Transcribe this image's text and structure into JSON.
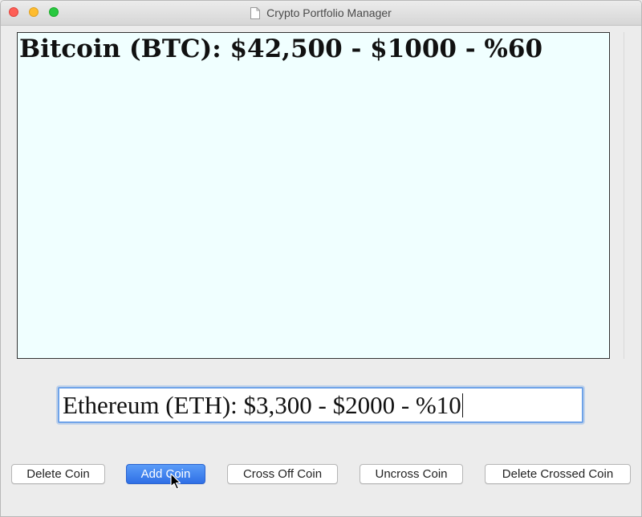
{
  "window": {
    "title": "Crypto Portfolio Manager",
    "icon": "document-icon"
  },
  "list": {
    "items": [
      "Bitcoin (BTC): $42,500 - $1000 - %60"
    ],
    "background": "#f0ffff"
  },
  "entry": {
    "value": "Ethereum (ETH): $3,300 - $2000 - %10"
  },
  "buttons": {
    "delete_coin": "Delete Coin",
    "add_coin": "Add Coin",
    "cross_off_coin": "Cross Off Coin",
    "uncross_coin": "Uncross Coin",
    "delete_crossed_coin": "Delete Crossed Coin"
  },
  "colors": {
    "accent": "#2f6fe6",
    "focus_ring": "#6fa3e8"
  }
}
